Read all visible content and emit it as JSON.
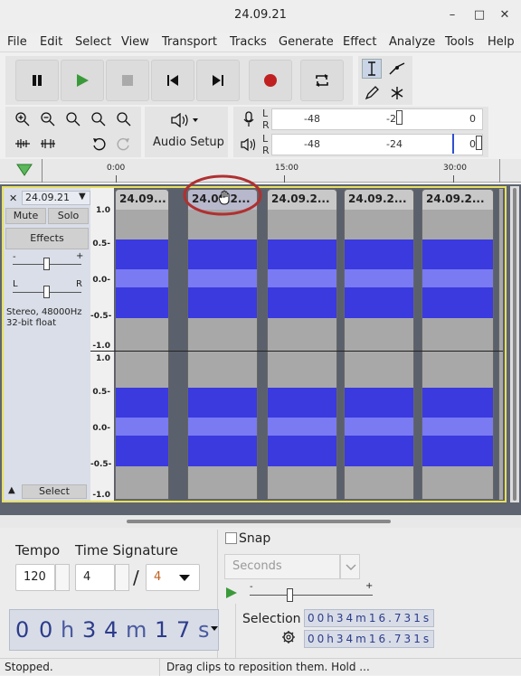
{
  "window": {
    "title": "24.09.21",
    "minimize": "–",
    "maximize": "□",
    "close": "✕"
  },
  "menu": [
    "File",
    "Edit",
    "Select",
    "View",
    "Transport",
    "Tracks",
    "Generate",
    "Effect",
    "Analyze",
    "Tools",
    "Help"
  ],
  "toolbar": {
    "audio_setup_label": "Audio Setup",
    "meter_record": {
      "L": "L",
      "R": "R",
      "ticks": [
        "-48",
        "-2",
        "0"
      ]
    },
    "meter_play": {
      "L": "L",
      "R": "R",
      "ticks": [
        "-48",
        "-24",
        "0"
      ]
    }
  },
  "ruler": {
    "ticks": [
      "0:00",
      "15:00",
      "30:00"
    ]
  },
  "track": {
    "name": "24.09.21",
    "mute_label": "Mute",
    "solo_label": "Solo",
    "effects_label": "Effects",
    "gain_minus": "-",
    "gain_plus": "+",
    "pan_left": "L",
    "pan_right": "R",
    "info_line1": "Stereo, 48000Hz",
    "info_line2": "32-bit float",
    "select_label": "Select",
    "scale": [
      "1.0",
      "0.5-",
      "0.0-",
      "-0.5-",
      "-1.0"
    ],
    "clips": [
      "24.09...",
      "24.09.2...",
      "24.09.2...",
      "24.09.2...",
      "24.09.2..."
    ]
  },
  "bottom": {
    "tempo_label": "Tempo",
    "tempo_value": "120",
    "time_sig_label": "Time Signature",
    "time_sig_num": "4",
    "time_sig_slash": "/",
    "time_sig_den": "4",
    "snap_label": "Snap",
    "snap_unit": "Seconds",
    "selection_label": "Selection",
    "time_display": [
      "0",
      "0",
      "h",
      "3",
      "4",
      "m",
      "1",
      "7",
      "s"
    ],
    "sel_start": "00h34m16.731s",
    "sel_end": "00h34m16.731s"
  },
  "status": {
    "left": "Stopped.",
    "right": "Drag clips to reposition them. Hold ..."
  },
  "colors": {
    "waveform": "#3a3adf",
    "waveform_rms": "#7a7af3",
    "highlight_ring": "#b03030",
    "play": "#3a9a3a",
    "record": "#c02020"
  }
}
